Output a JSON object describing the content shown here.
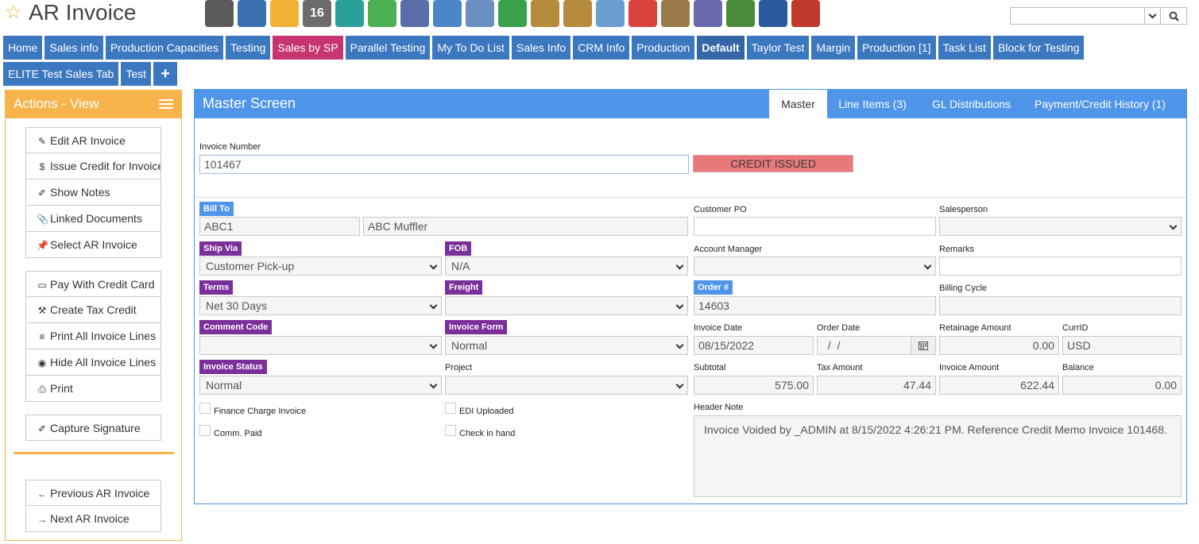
{
  "app": {
    "title": "AR Invoice"
  },
  "toolbar_icons": [
    {
      "name": "bank-icon",
      "color": "#5a5a5a"
    },
    {
      "name": "user-icon",
      "color": "#3a6fb0"
    },
    {
      "name": "weather-icon",
      "color": "#f2b233"
    },
    {
      "name": "calendar-icon",
      "color": "#6c6c6c",
      "text": "16"
    },
    {
      "name": "clock-icon",
      "color": "#2aa198"
    },
    {
      "name": "checkmark-icon",
      "color": "#4caf50"
    },
    {
      "name": "list-box-icon",
      "color": "#5a6ea8"
    },
    {
      "name": "magnifier-icon",
      "color": "#4a86c8"
    },
    {
      "name": "bus-icon",
      "color": "#6a8fc0"
    },
    {
      "name": "basket-icon",
      "color": "#3aa04a"
    },
    {
      "name": "download-box-icon",
      "color": "#b58a3c"
    },
    {
      "name": "upload-box-icon",
      "color": "#b58a3c"
    },
    {
      "name": "hand-money-icon",
      "color": "#6a9fd0"
    },
    {
      "name": "dollar-speech-icon",
      "color": "#d9433e"
    },
    {
      "name": "document-icon",
      "color": "#9a7a4a"
    },
    {
      "name": "pencil-icon",
      "color": "#6a6ab0"
    },
    {
      "name": "cash-icon",
      "color": "#4a8a3a"
    },
    {
      "name": "phone-icon",
      "color": "#2a5aa0"
    },
    {
      "name": "factory-icon",
      "color": "#c0392b"
    }
  ],
  "search": {
    "value": ""
  },
  "tabs": [
    {
      "label": "Home",
      "style": ""
    },
    {
      "label": "Sales info",
      "style": ""
    },
    {
      "label": "Production Capacities",
      "style": ""
    },
    {
      "label": "Testing",
      "style": ""
    },
    {
      "label": "Sales by SP",
      "style": "pink"
    },
    {
      "label": "Parallel Testing",
      "style": ""
    },
    {
      "label": "My To Do List",
      "style": ""
    },
    {
      "label": "Sales Info",
      "style": ""
    },
    {
      "label": "CRM Info",
      "style": ""
    },
    {
      "label": "Production",
      "style": ""
    },
    {
      "label": "Default",
      "style": "bold"
    },
    {
      "label": "Taylor Test",
      "style": ""
    },
    {
      "label": "Margin",
      "style": ""
    },
    {
      "label": "Production [1]",
      "style": ""
    },
    {
      "label": "Task List",
      "style": ""
    },
    {
      "label": "Block for Testing",
      "style": ""
    },
    {
      "label": "ELITE Test Sales Tab",
      "style": ""
    },
    {
      "label": "Test",
      "style": ""
    },
    {
      "label": "+",
      "style": "plus"
    }
  ],
  "actions": {
    "title": "Actions - View",
    "group1": [
      {
        "label": "Edit AR Invoice",
        "icon": "✎"
      },
      {
        "label": "Issue Credit for Invoice",
        "icon": "$"
      },
      {
        "label": "Show Notes",
        "icon": "✐"
      },
      {
        "label": "Linked Documents",
        "icon": "📎"
      },
      {
        "label": "Select AR Invoice",
        "icon": "📌"
      }
    ],
    "group2": [
      {
        "label": "Pay With Credit Card",
        "icon": "▭"
      },
      {
        "label": "Create Tax Credit",
        "icon": "⚒"
      },
      {
        "label": "Print All Invoice Lines",
        "icon": "≡"
      },
      {
        "label": "Hide All Invoice Lines",
        "icon": "◉"
      },
      {
        "label": "Print",
        "icon": "⎙"
      }
    ],
    "group3": [
      {
        "label": "Capture Signature",
        "icon": "✐"
      }
    ],
    "group4": [
      {
        "label": "Previous AR Invoice",
        "icon": "←"
      },
      {
        "label": "Next AR Invoice",
        "icon": "→"
      }
    ]
  },
  "panel": {
    "title": "Master Screen",
    "tabs": [
      "Master",
      "Line Items (3)",
      "GL Distributions",
      "Payment/Credit History (1)"
    ]
  },
  "form": {
    "invoice_number_label": "Invoice Number",
    "invoice_number": "101467",
    "status_badge": "CREDIT ISSUED",
    "bill_to_label": "Bill To",
    "bill_to_code": "ABC1",
    "bill_to_name": "ABC Muffler",
    "customer_po_label": "Customer PO",
    "customer_po": "",
    "salesperson_label": "Salesperson",
    "salesperson": "",
    "ship_via_label": "Ship Via",
    "ship_via": "Customer Pick-up",
    "fob_label": "FOB",
    "fob": "N/A",
    "account_manager_label": "Account Manager",
    "account_manager": "",
    "remarks_label": "Remarks",
    "remarks": "",
    "terms_label": "Terms",
    "terms": "Net 30 Days",
    "freight_label": "Freight",
    "freight": "",
    "order_no_label": "Order #",
    "order_no": "14603",
    "billing_cycle_label": "Billing Cycle",
    "billing_cycle": "",
    "comment_code_label": "Comment Code",
    "comment_code": "",
    "invoice_form_label": "Invoice Form",
    "invoice_form": "Normal",
    "invoice_date_label": "Invoice Date",
    "invoice_date": "08/15/2022",
    "order_date_label": "Order Date",
    "order_date": "  /  /",
    "retainage_label": "Retainage Amount",
    "retainage": "0.00",
    "currid_label": "CurrID",
    "currid": "USD",
    "invoice_status_label": "Invoice Status",
    "invoice_status": "Normal",
    "project_label": "Project",
    "project": "",
    "subtotal_label": "Subtotal",
    "subtotal": "575.00",
    "tax_amount_label": "Tax Amount",
    "tax_amount": "47.44",
    "invoice_amount_label": "Invoice Amount",
    "invoice_amount": "622.44",
    "balance_label": "Balance",
    "balance": "0.00",
    "finance_charge_label": "Finance Charge Invoice",
    "edi_uploaded_label": "EDI Uploaded",
    "comm_paid_label": "Comm. Paid",
    "check_in_hand_label": "Check in hand",
    "header_note_label": "Header Note",
    "header_note": "Invoice Voided by _ADMIN at 8/15/2022 4:26:21 PM.  Reference Credit Memo Invoice 101468."
  }
}
